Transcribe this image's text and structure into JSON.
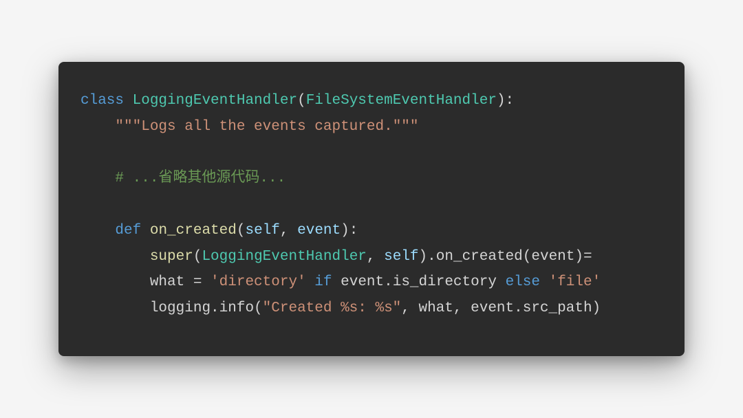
{
  "code": {
    "line1": {
      "kw_class": "class",
      "cls_name": "LoggingEventHandler",
      "lparen": "(",
      "base": "FileSystemEventHandler",
      "rparen_colon": "):"
    },
    "line2": {
      "indent": "    ",
      "docstring": "\"\"\"Logs all the events captured.\"\"\""
    },
    "line3": {
      "indent": "    ",
      "comment": "# ...省略其他源代码..."
    },
    "line4": {
      "indent": "    ",
      "kw_def": "def",
      "fn_name": "on_created",
      "lparen": "(",
      "self": "self",
      "comma_sp": ", ",
      "arg": "event",
      "rparen_colon": "):"
    },
    "line5": {
      "indent": "        ",
      "super_call": "super",
      "lparen": "(",
      "cls": "LoggingEventHandler",
      "comma_sp": ", ",
      "self": "self",
      "rparen": ")",
      "dot_on": ".on_created(event)="
    },
    "line6": {
      "indent": "        ",
      "var": "what = ",
      "str1": "'directory'",
      "sp_if": " if ",
      "if_kw": "if",
      "cond": "event.is_directory",
      "sp_else": " ",
      "else_kw": "else",
      "sp2": " ",
      "str2": "'file'"
    },
    "line7": {
      "indent": "        ",
      "call": "logging.info(",
      "str": "\"Created %s: %s\"",
      "args": ", what, event.src_path)"
    }
  }
}
